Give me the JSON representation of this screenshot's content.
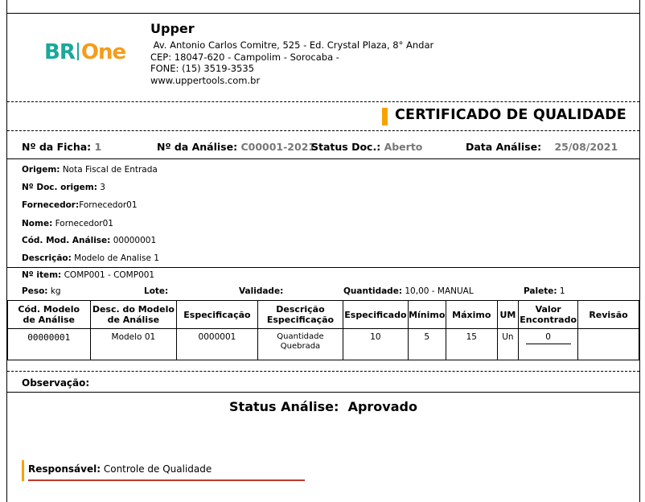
{
  "header": {
    "logo_left": "BR",
    "logo_right": "One",
    "company": "Upper",
    "address_lines": [
      " Av. Antonio Carlos Comitre, 525 - Ed. Crystal Plaza, 8° Andar",
      "CEP: 18047-620 - Campolim - Sorocaba -",
      "FONE: (15) 3519-3535",
      "www.uppertools.com.br"
    ],
    "title": "CERTIFICADO DE QUALIDADE",
    "accent_color": "#f5a300",
    "logo_colors": {
      "br": "#1aa89a",
      "one": "#f59c1a"
    }
  },
  "summary": {
    "ficha_label": "Nº da Ficha:",
    "ficha_value": "1",
    "analise_label": "Nº da Análise:",
    "analise_value": "C00001-2021",
    "status_label": "Status Doc.:",
    "status_value": "Aberto",
    "data_label": "Data Análise:",
    "data_value": "25/08/2021"
  },
  "details": [
    {
      "label": "Origem:",
      "value": "Nota Fiscal de Entrada"
    },
    {
      "label": "Nº Doc. origem:",
      "value": "3"
    },
    {
      "label": "Fornecedor:",
      "value": "Fornecedor01"
    },
    {
      "label": "Nome:",
      "value": "Fornecedor01"
    },
    {
      "label": "Cód. Mod. Análise:",
      "value": "00000001"
    },
    {
      "label": "Descrição:",
      "value": "Modelo de Analise 1"
    }
  ],
  "item": {
    "item_label": "Nº item:",
    "item_value": "COMP001 - COMP001",
    "peso_label": "Peso:",
    "peso_value": "kg",
    "lote_label": "Lote:",
    "lote_value": "",
    "validade_label": "Validade:",
    "validade_value": "",
    "quantidade_label": "Quantidade:",
    "quantidade_value": "10,00 - MANUAL",
    "palete_label": "Palete:",
    "palete_value": "1"
  },
  "table": {
    "headers": [
      "Cód. Modelo\nde Análise",
      "Desc. do Modelo\nde Análise",
      "Especificação",
      "Descrição\nEspecificação",
      "Especificado",
      "Mínimo",
      "Máximo",
      "UM",
      "Valor\nEncontrado",
      "Revisão"
    ],
    "rows": [
      [
        "00000001",
        "Modelo 01",
        "0000001",
        "Quantidade\nQuebrada",
        "10",
        "5",
        "15",
        "Un",
        "0",
        ""
      ]
    ]
  },
  "observacao_label": "Observação:",
  "status_analise": {
    "label": "Status Análise:",
    "value": "Aprovado"
  },
  "responsavel": {
    "label": "Responsável:",
    "value": "Controle de Qualidade"
  }
}
